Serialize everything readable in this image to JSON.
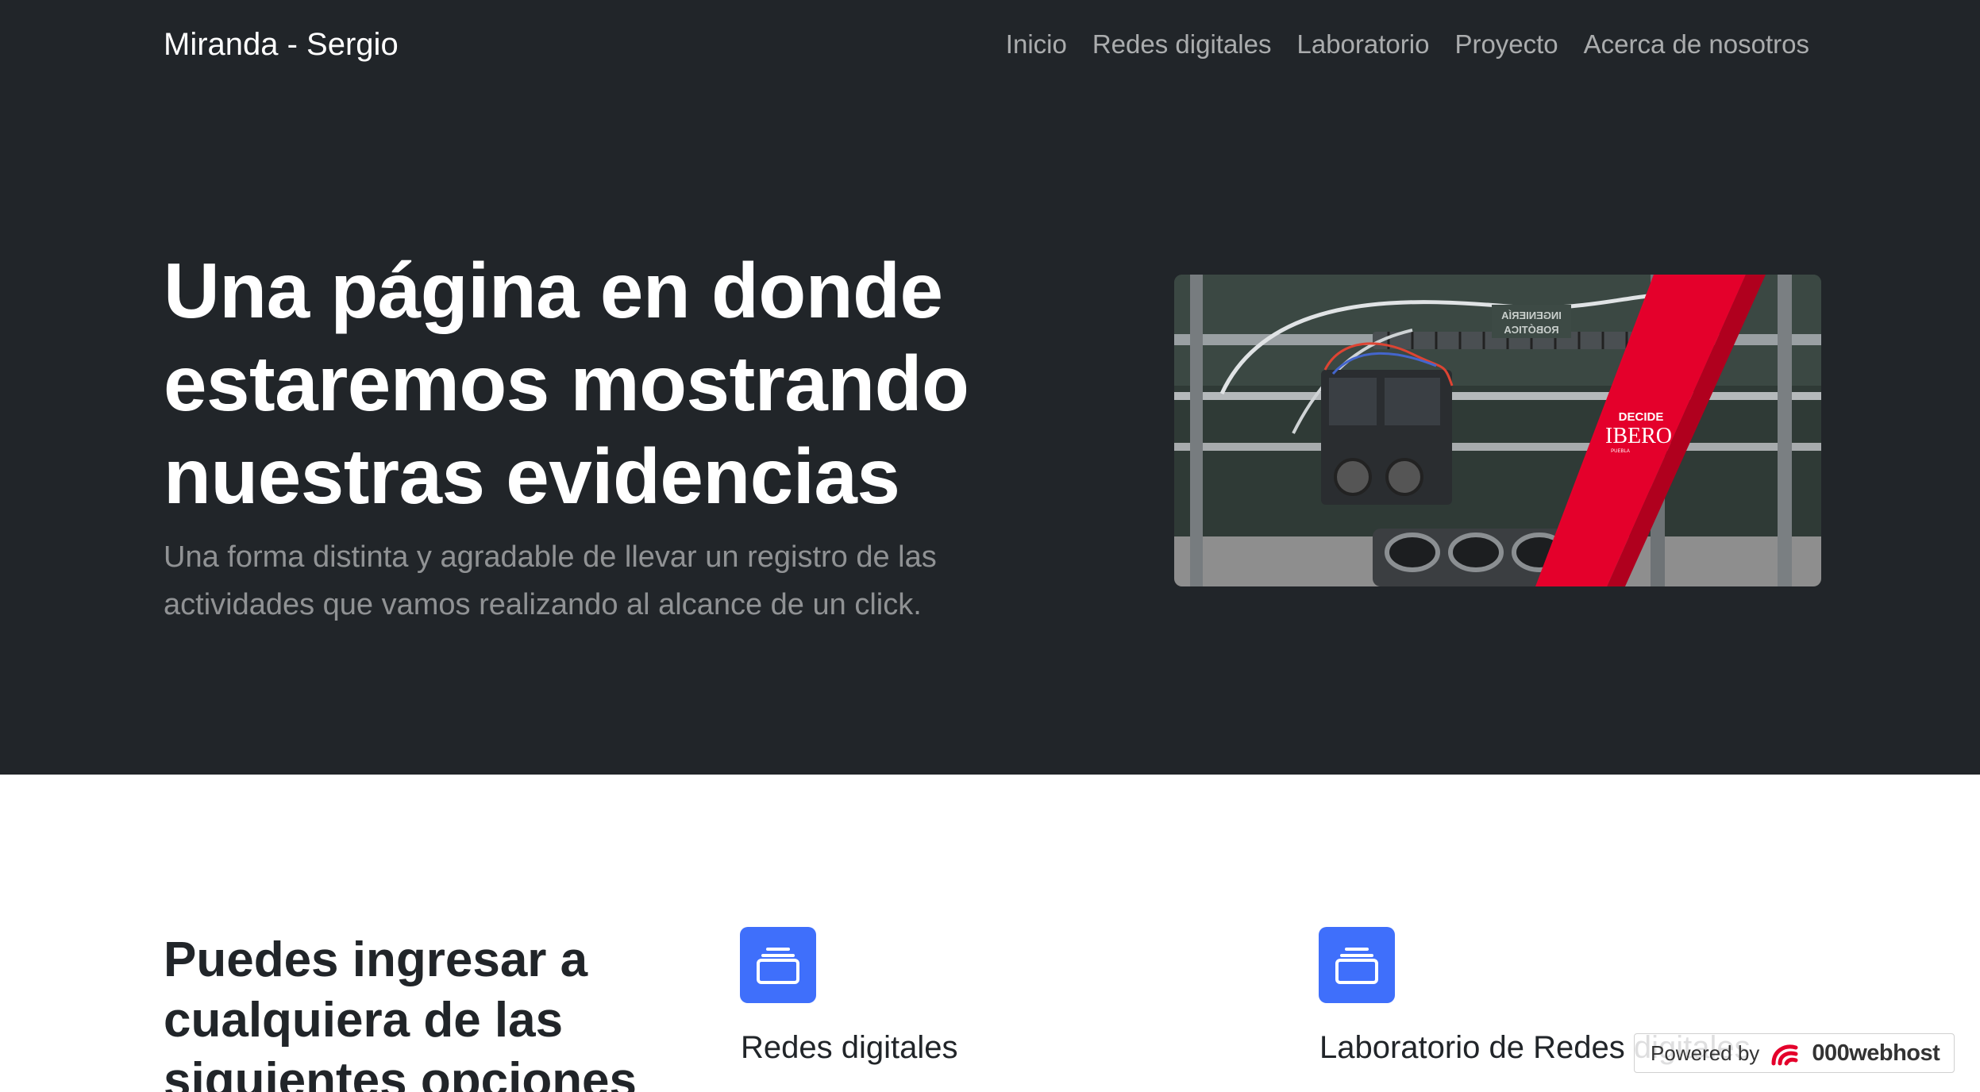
{
  "navbar": {
    "brand": "Miranda - Sergio",
    "links": [
      "Inicio",
      "Redes digitales",
      "Laboratorio",
      "Proyecto",
      "Acerca de nosotros"
    ]
  },
  "hero": {
    "title": "Una página en donde estaremos mostrando nuestras evidencias",
    "lead": "Una forma distinta y agradable de llevar un registro de las actividades que vamos realizando al alcance de un click.",
    "image": {
      "badge_top": "DECIDE",
      "badge_main": "IBERO",
      "badge_sub": "PUEBLA",
      "sign_line1": "INGENIERÍA",
      "sign_line2": "ROBÓTICA"
    }
  },
  "features": {
    "title": "Puedes ingresar a cualquiera de las siguientes opciones",
    "items": [
      {
        "icon": "collection-icon",
        "heading": "Redes digitales"
      },
      {
        "icon": "collection-icon",
        "heading": "Laboratorio de Redes digitales"
      }
    ]
  },
  "host_badge": {
    "powered": "Powered by",
    "name": "000webhost"
  },
  "colors": {
    "dark_bg": "#212529",
    "accent_blue": "#3f6ffb",
    "ibero_red": "#e4002b"
  }
}
